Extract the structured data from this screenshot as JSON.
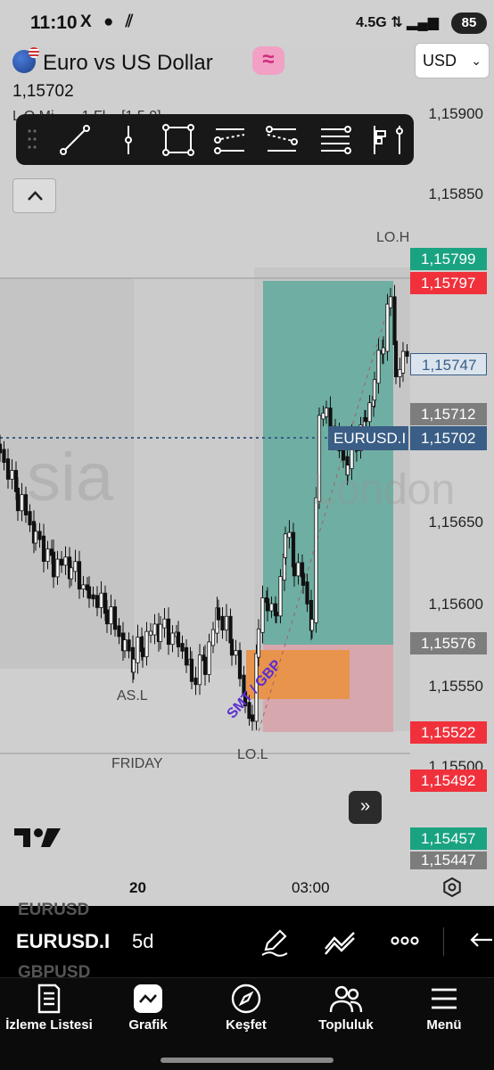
{
  "status_bar": {
    "time": "11:10",
    "left_icons": "X ● ⫽",
    "right_icons": "4.5G ⇅ ▂▄▆",
    "battery": "85"
  },
  "header": {
    "title": "Euro vs US Dollar",
    "price": "1,15702",
    "currency": "USD",
    "ghost_text": "L O Mi... ...1 Fl... [1 5 0]"
  },
  "price_axis": [
    "1,15900",
    "1,15850",
    "1,15650",
    "1,15600",
    "1,15550",
    "1,15500"
  ],
  "price_tags": [
    {
      "value": "1,15799",
      "color": "#1aa380"
    },
    {
      "value": "1,15797",
      "color": "#f0313c"
    },
    {
      "value": "1,15747",
      "color": "outline"
    },
    {
      "value": "1,15712",
      "color": "#7d7d7d"
    },
    {
      "value": "1,15702",
      "color": "#3a5e86"
    },
    {
      "value": "1,15576",
      "color": "#7d7d7d"
    },
    {
      "value": "1,15522",
      "color": "#f0313c"
    },
    {
      "value": "1,15492",
      "color": "#f0313c"
    },
    {
      "value": "1,15457",
      "color": "#1aa380"
    },
    {
      "value": "1,15447",
      "color": "#7d7d7d"
    }
  ],
  "chart_labels": {
    "lo_h": "LO.H",
    "as_l": "AS.L",
    "lo_l": "LO.L",
    "friday": "FRIDAY",
    "smt": "SMT / GBP",
    "asia": "sia",
    "london": "London",
    "symbol_pill": "EURUSD.I"
  },
  "time_axis": [
    "20",
    "03:00"
  ],
  "symbol_bar": {
    "ghost_above": "EURUSD",
    "symbol": "EURUSD.I",
    "timeframe": "5d",
    "ghost_below": "GBPUSD"
  },
  "nav": [
    {
      "label": "İzleme Listesi",
      "icon": "watchlist-icon"
    },
    {
      "label": "Grafik",
      "icon": "chart-icon"
    },
    {
      "label": "Keşfet",
      "icon": "compass-icon"
    },
    {
      "label": "Topluluk",
      "icon": "community-icon"
    },
    {
      "label": "Menü",
      "icon": "menu-icon"
    }
  ]
}
